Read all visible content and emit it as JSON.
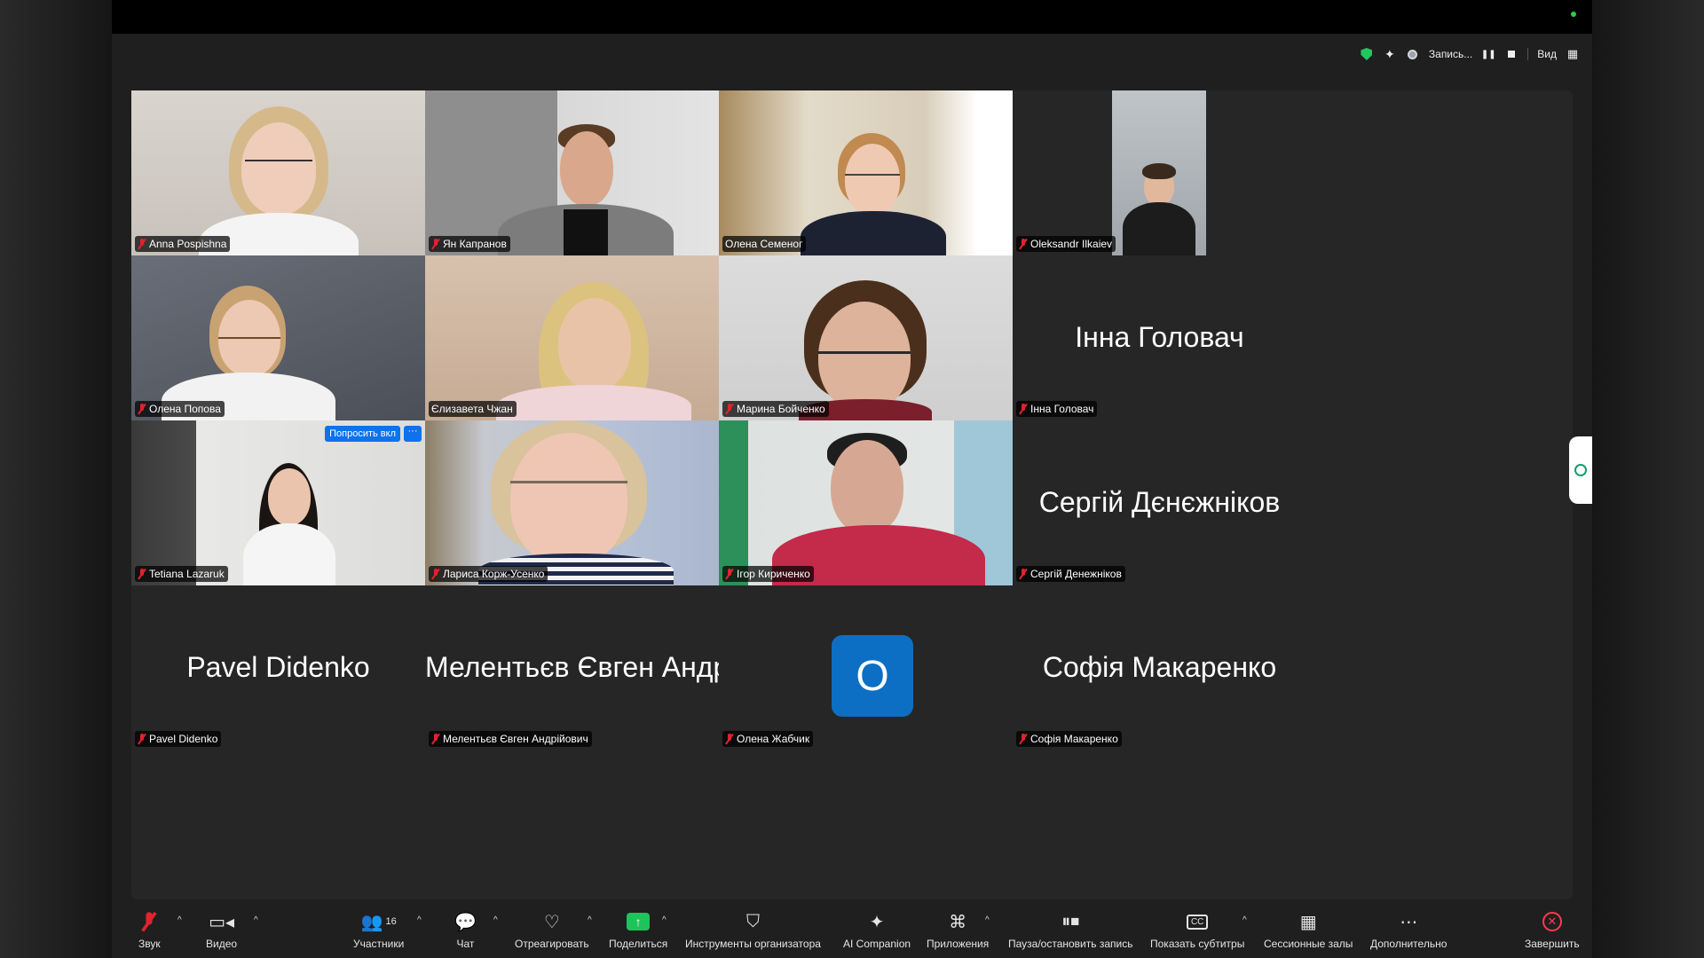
{
  "status": {
    "recording_label": "Запись...",
    "view_label": "Вид"
  },
  "tiles": {
    "anna": {
      "name": "Anna Pospishna"
    },
    "yan": {
      "name": "Ян Капранов"
    },
    "olena_s": {
      "name": "Олена Семеног"
    },
    "oleksandr": {
      "name": "Oleksandr Ilkaiev"
    },
    "olena_p": {
      "name": "Олена Попова"
    },
    "elizaveta": {
      "name": "Єлизавета Чжан"
    },
    "maryna": {
      "name": "Марина Бойченко"
    },
    "inna": {
      "name": "Інна Головач",
      "big_name": "Інна Головач"
    },
    "tetiana": {
      "name": "Tetiana Lazaruk",
      "ask_label": "Попросить вкл",
      "more_label": "···"
    },
    "larysa": {
      "name": "Лариса Корж-Усенко"
    },
    "igor": {
      "name": "Ігор Кириченко"
    },
    "serhii": {
      "name": "Сергій Денежніков",
      "big_name": "Сергій Дєнєжніков"
    },
    "pavel": {
      "name": "Pavel Didenko",
      "big_name": "Pavel Didenko"
    },
    "melentiev": {
      "name": "Мелентьєв Євген Андрійович",
      "big_name": "Мелентьєв Євген Андр..."
    },
    "olena_zh": {
      "name": "Олена Жабчик",
      "avatar_letter": "О"
    },
    "sofiia": {
      "name": "Софія Макаренко",
      "big_name": "Софія Макаренко"
    }
  },
  "toolbar": {
    "audio": "Звук",
    "video": "Видео",
    "participants": "Участники",
    "participants_count": "16",
    "chat": "Чат",
    "react": "Отреагировать",
    "share": "Поделиться",
    "host_tools": "Инструменты организатора",
    "ai_companion": "AI Companion",
    "apps": "Приложения",
    "pause_record": "Пауза/остановить запись",
    "captions": "Показать субтитры",
    "breakout": "Сессионные залы",
    "more": "Дополнительно",
    "end": "Завершить"
  },
  "colors": {
    "accent": "#0e72ed",
    "active_speaker": "#3fae49",
    "share_green": "#20c35b",
    "end_red": "#ff3a4f",
    "mic_off_red": "#e0232e"
  },
  "icons": [
    "shield-icon",
    "sparkle-icon",
    "record-icon",
    "pause-icon",
    "stop-icon",
    "grid-view-icon",
    "mic-off-icon",
    "video-icon",
    "participants-icon",
    "chat-icon",
    "heart-icon",
    "share-icon",
    "shield-host-icon",
    "ai-sparkle-icon",
    "apps-icon",
    "pause-stop-record-icon",
    "cc-icon",
    "breakout-icon",
    "more-icon",
    "end-icon"
  ]
}
